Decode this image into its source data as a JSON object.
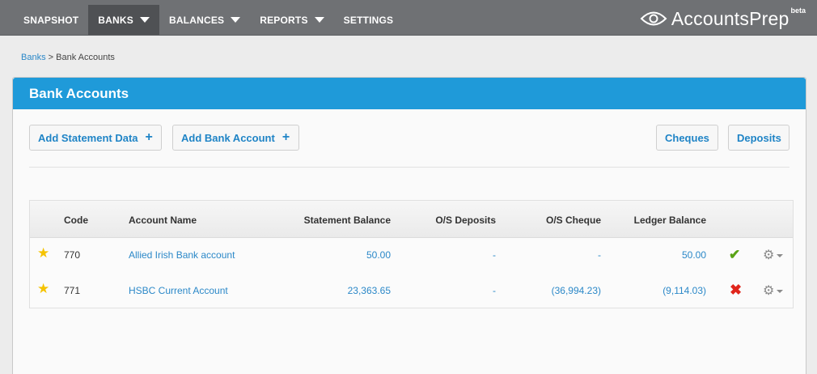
{
  "nav": {
    "items": [
      {
        "label": "SNAPSHOT"
      },
      {
        "label": "BANKS"
      },
      {
        "label": "BALANCES"
      },
      {
        "label": "REPORTS"
      },
      {
        "label": "SETTINGS"
      }
    ],
    "logo_text": "AccountsPrep",
    "logo_badge": "beta"
  },
  "breadcrumb": {
    "parent": "Banks",
    "separator": " > ",
    "current": "Bank Accounts"
  },
  "panel": {
    "title": "Bank Accounts",
    "buttons": {
      "add_statement": "Add Statement Data",
      "add_bank": "Add Bank Account",
      "cheques": "Cheques",
      "deposits": "Deposits"
    }
  },
  "table": {
    "headers": {
      "code": "Code",
      "name": "Account Name",
      "statement": "Statement Balance",
      "deposits": "O/S Deposits",
      "cheque": "O/S Cheque",
      "ledger": "Ledger Balance"
    },
    "rows": [
      {
        "code": "770",
        "name": "Allied Irish Bank account",
        "statement": "50.00",
        "deposits": "-",
        "cheque": "-",
        "ledger": "50.00",
        "status": "reconciled"
      },
      {
        "code": "771",
        "name": "HSBC Current Account",
        "statement": "23,363.65",
        "deposits": "-",
        "cheque": "(36,994.23)",
        "ledger": "(9,114.03)",
        "status": "unreconciled"
      }
    ]
  },
  "colors": {
    "nav_bg": "#6f7174",
    "nav_active": "#4f5154",
    "panel_header": "#1f9ad9",
    "link": "#2b88c8",
    "star": "#f5c300",
    "ok": "#5aa316",
    "error": "#e0251b"
  },
  "icons": {
    "favourite": "star-icon",
    "reconciled": "check-icon",
    "unreconciled": "cross-icon",
    "actions": "gear-icon",
    "add": "plus-icon",
    "logo": "eye-icon"
  }
}
